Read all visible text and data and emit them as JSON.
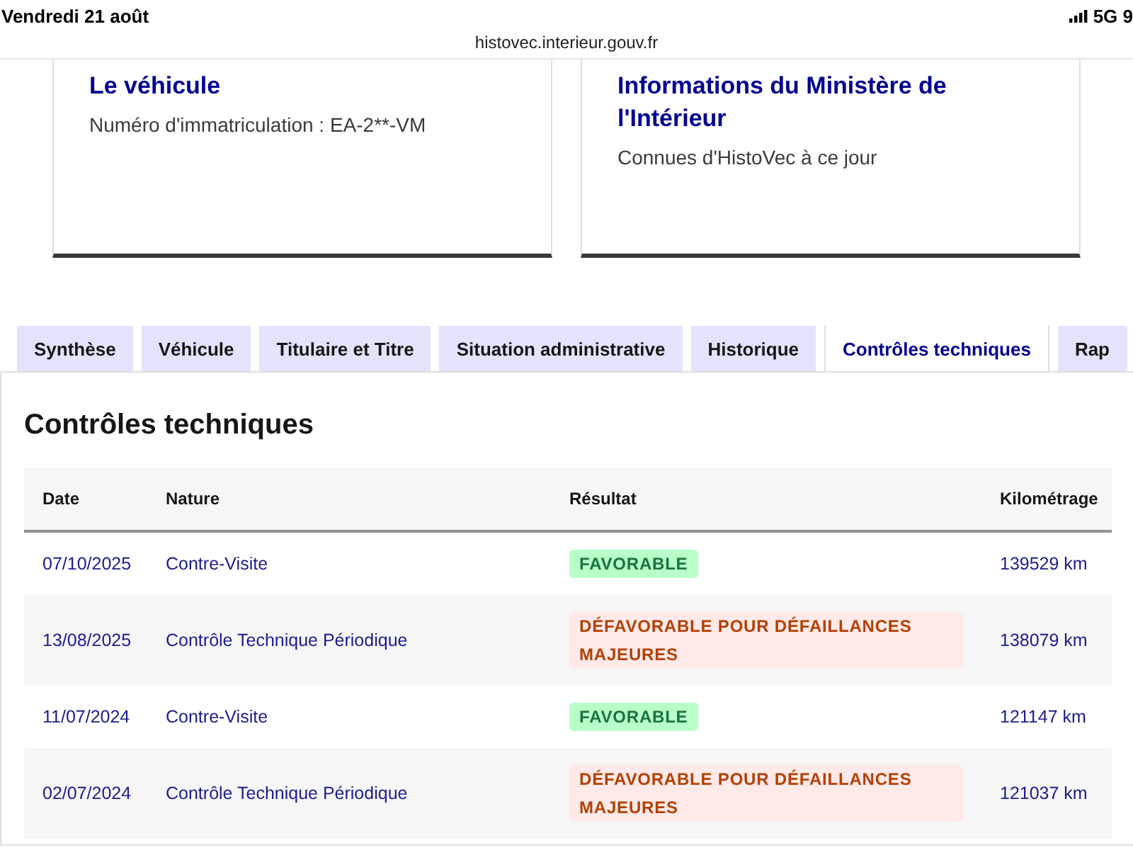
{
  "status_bar": {
    "date": "Vendredi 21 août",
    "network": "5G 9"
  },
  "address_bar": {
    "url": "histovec.interieur.gouv.fr"
  },
  "cards": [
    {
      "title": "Le véhicule",
      "text": "Numéro d'immatriculation : EA-2**-VM"
    },
    {
      "title": "Informations du Ministère de l'Intérieur",
      "text": "Connues d'HistoVec à ce jour"
    }
  ],
  "tabs": [
    {
      "label": "Synthèse",
      "selected": false
    },
    {
      "label": "Véhicule",
      "selected": false
    },
    {
      "label": "Titulaire et Titre",
      "selected": false
    },
    {
      "label": "Situation administrative",
      "selected": false
    },
    {
      "label": "Historique",
      "selected": false
    },
    {
      "label": "Contrôles techniques",
      "selected": true
    },
    {
      "label": "Rap",
      "selected": false
    }
  ],
  "section": {
    "title": "Contrôles techniques",
    "table": {
      "columns": [
        "Date",
        "Nature",
        "Résultat",
        "Kilométrage"
      ],
      "rows": [
        {
          "date": "07/10/2025",
          "nature": "Contre-Visite",
          "result": {
            "label": "FAVORABLE",
            "kind": "success"
          },
          "mileage": "139529 km"
        },
        {
          "date": "13/08/2025",
          "nature": "Contrôle Technique Périodique",
          "result": {
            "label": "DÉFAVORABLE POUR DÉFAILLANCES MAJEURES",
            "kind": "error"
          },
          "mileage": "138079 km"
        },
        {
          "date": "11/07/2024",
          "nature": "Contre-Visite",
          "result": {
            "label": "FAVORABLE",
            "kind": "success"
          },
          "mileage": "121147 km"
        },
        {
          "date": "02/07/2024",
          "nature": "Contrôle Technique Périodique",
          "result": {
            "label": "DÉFAVORABLE POUR DÉFAILLANCES MAJEURES",
            "kind": "error"
          },
          "mileage": "121037 km"
        }
      ]
    }
  }
}
